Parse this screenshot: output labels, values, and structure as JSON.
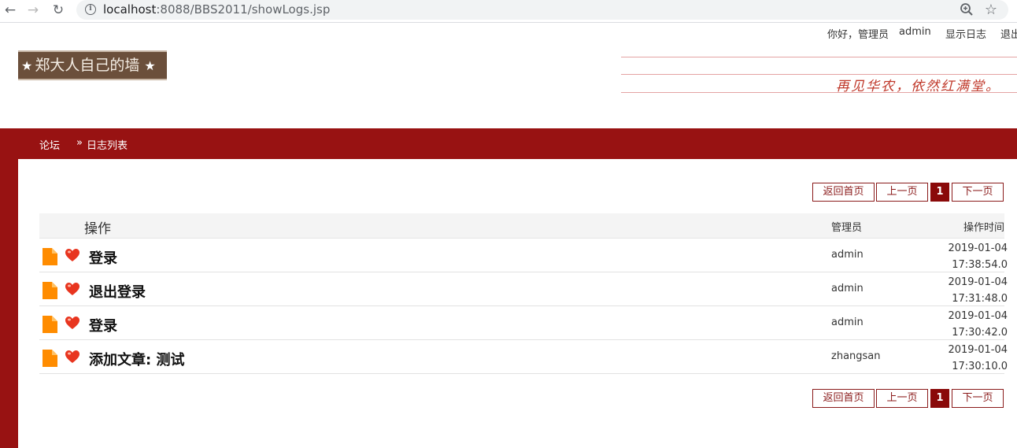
{
  "browser": {
    "url_host": "localhost",
    "url_path": ":8088/BBS2011/showLogs.jsp"
  },
  "userbar": {
    "greeting": "你好，管理员",
    "username": "admin",
    "logs_link": "显示日志",
    "exit_link": "退出"
  },
  "logo": {
    "text": "郑大人自己的墙"
  },
  "slogan": "再见华农，依然红满堂。",
  "breadcrumb": {
    "home": "论坛",
    "separator": "»",
    "current": "日志列表"
  },
  "pager": {
    "first": "返回首页",
    "prev": "上一页",
    "current": "1",
    "next": "下一页"
  },
  "table": {
    "headers": {
      "operation": "操作",
      "admin": "管理员",
      "time": "操作时间"
    },
    "rows": [
      {
        "operation": "登录",
        "admin": "admin",
        "date": "2019-01-04",
        "time": "17:38:54.0"
      },
      {
        "operation": "退出登录",
        "admin": "admin",
        "date": "2019-01-04",
        "time": "17:31:48.0"
      },
      {
        "operation": "登录",
        "admin": "admin",
        "date": "2019-01-04",
        "time": "17:30:42.0"
      },
      {
        "operation": "添加文章: 测试",
        "admin": "zhangsan",
        "date": "2019-01-04",
        "time": "17:30:10.0"
      }
    ]
  },
  "colors": {
    "brand_red": "#981212",
    "logo_brown": "#6b4f3b",
    "doc_icon": "#ff8c00",
    "heart": "#e8351f"
  },
  "icons": {
    "row_doc": "document-icon",
    "row_heart": "heart-icon"
  }
}
